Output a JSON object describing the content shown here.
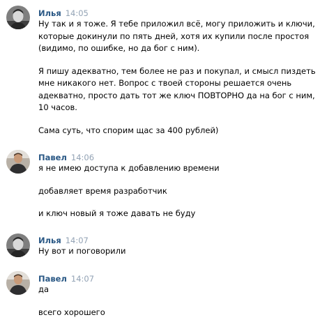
{
  "messages": [
    {
      "author": "Илья",
      "time": "14:05",
      "avatar_icon": "user-avatar-ilya",
      "lines": [
        "Ну так и я тоже. Я тебе приложил всё, могу приложить и ключи, которые докинули по пять дней, хотя их купили после простоя (видимо, по ошибке, но да бог с ним).",
        "Я пишу адекватно, тем более не раз и покупал, и смысл пиздеть мне никакого нет. Вопрос с твоей стороны решается очень адекватно, просто дать тот же ключ ПОВТОРНО да на бог с ним, 10 часов.",
        "Сама суть, что спорим щас за 400 рублей)"
      ]
    },
    {
      "author": "Павел",
      "time": "14:06",
      "avatar_icon": "user-avatar-pavel",
      "lines": [
        "я не имею доступа к добавлению времени",
        "добавляет время разработчик",
        "и ключ новый я тоже давать не буду"
      ]
    },
    {
      "author": "Илья",
      "time": "14:07",
      "avatar_icon": "user-avatar-ilya",
      "lines": [
        "Ну вот и поговорили"
      ]
    },
    {
      "author": "Павел",
      "time": "14:07",
      "avatar_icon": "user-avatar-pavel",
      "lines": [
        "да",
        "всего хорошего"
      ]
    }
  ],
  "colors": {
    "author": "#2a5885",
    "time": "#93a3b5",
    "text": "#000000"
  }
}
